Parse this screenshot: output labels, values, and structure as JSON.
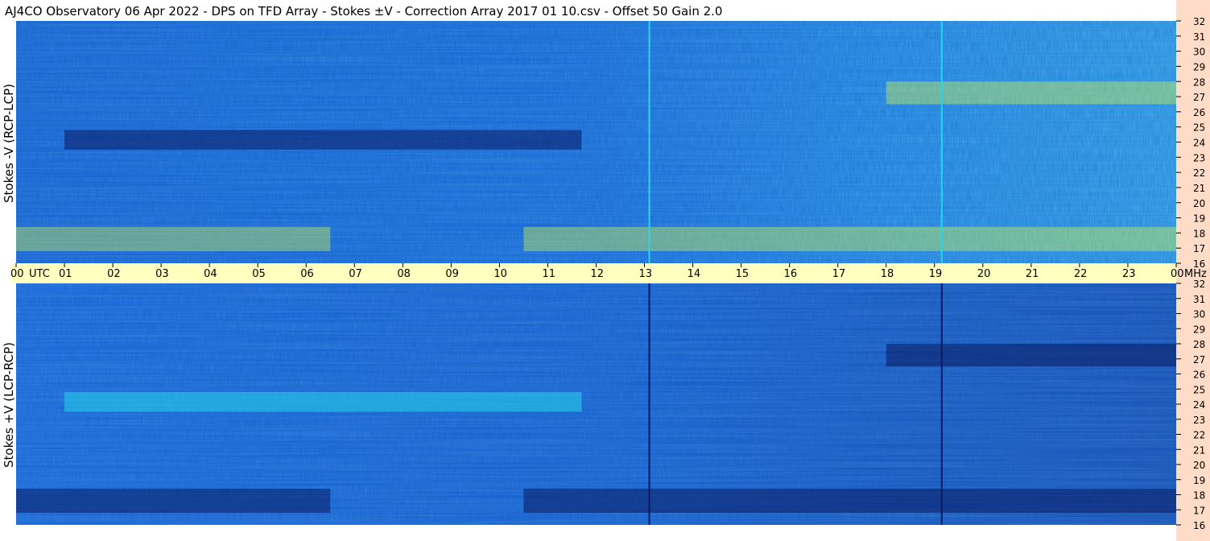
{
  "title": "AJ4CO Observatory  06 Apr 2022  -  DPS on TFD Array  -  Stokes ±V  -  Correction Array 2017 01 10.csv  -  Offset 50  Gain 2.0",
  "colors": {
    "background": "#ffffff",
    "time_band": "#ffffc0",
    "freq_strip": "#ffdcc8",
    "spectrogram_base": "#1a5fe0",
    "bright_band": "#27d6e8",
    "hot_band": "#e0ff40",
    "dark_band": "#0a1a60"
  },
  "chart_data": [
    {
      "type": "heatmap",
      "panel": "top",
      "ylabel": "Stokes -V (RCP-LCP)",
      "y_unit": "MHz",
      "yticks": [
        "32",
        "31",
        "30",
        "29",
        "28",
        "27",
        "26",
        "25",
        "24",
        "23",
        "22",
        "21",
        "20",
        "19",
        "18",
        "17",
        "16"
      ],
      "ylim": [
        16,
        32
      ],
      "xlim": [
        "00:00 UTC",
        "24:00 UTC"
      ],
      "features": [
        {
          "kind": "dark_band",
          "freq_mhz": [
            23.5,
            24.8
          ],
          "time_h": [
            1.0,
            11.7
          ]
        },
        {
          "kind": "hot_band",
          "freq_mhz": [
            26.5,
            28.0
          ],
          "time_h": [
            18.0,
            24.0
          ]
        },
        {
          "kind": "hot_band",
          "freq_mhz": [
            16.8,
            18.4
          ],
          "time_h": [
            0.0,
            6.5
          ]
        },
        {
          "kind": "hot_band",
          "freq_mhz": [
            16.8,
            18.4
          ],
          "time_h": [
            10.5,
            24.0
          ]
        },
        {
          "kind": "bright_line",
          "time_h": [
            13.1,
            19.15
          ]
        }
      ]
    },
    {
      "type": "heatmap",
      "panel": "bottom",
      "ylabel": "Stokes +V (LCP-RCP)",
      "y_unit": "MHz",
      "yticks": [
        "32",
        "31",
        "30",
        "29",
        "28",
        "27",
        "26",
        "25",
        "24",
        "23",
        "22",
        "21",
        "20",
        "19",
        "18",
        "17",
        "16"
      ],
      "ylim": [
        16,
        32
      ],
      "xlim": [
        "00:00 UTC",
        "24:00 UTC"
      ],
      "features": [
        {
          "kind": "bright_band",
          "freq_mhz": [
            23.5,
            24.8
          ],
          "time_h": [
            1.0,
            11.7
          ]
        },
        {
          "kind": "dark_band",
          "freq_mhz": [
            26.5,
            28.0
          ],
          "time_h": [
            18.0,
            24.0
          ]
        },
        {
          "kind": "dark_band",
          "freq_mhz": [
            16.8,
            18.4
          ],
          "time_h": [
            0.0,
            6.5
          ]
        },
        {
          "kind": "dark_band",
          "freq_mhz": [
            16.8,
            18.4
          ],
          "time_h": [
            10.5,
            24.0
          ]
        },
        {
          "kind": "dark_line",
          "time_h": [
            13.1,
            19.15
          ]
        }
      ]
    }
  ],
  "time_axis": {
    "ticks": [
      "00",
      "01",
      "02",
      "03",
      "04",
      "05",
      "06",
      "07",
      "08",
      "09",
      "10",
      "11",
      "12",
      "13",
      "14",
      "15",
      "16",
      "17",
      "18",
      "19",
      "20",
      "21",
      "22",
      "23",
      "00"
    ],
    "utc_label": "UTC",
    "unit_label": "MHz"
  }
}
